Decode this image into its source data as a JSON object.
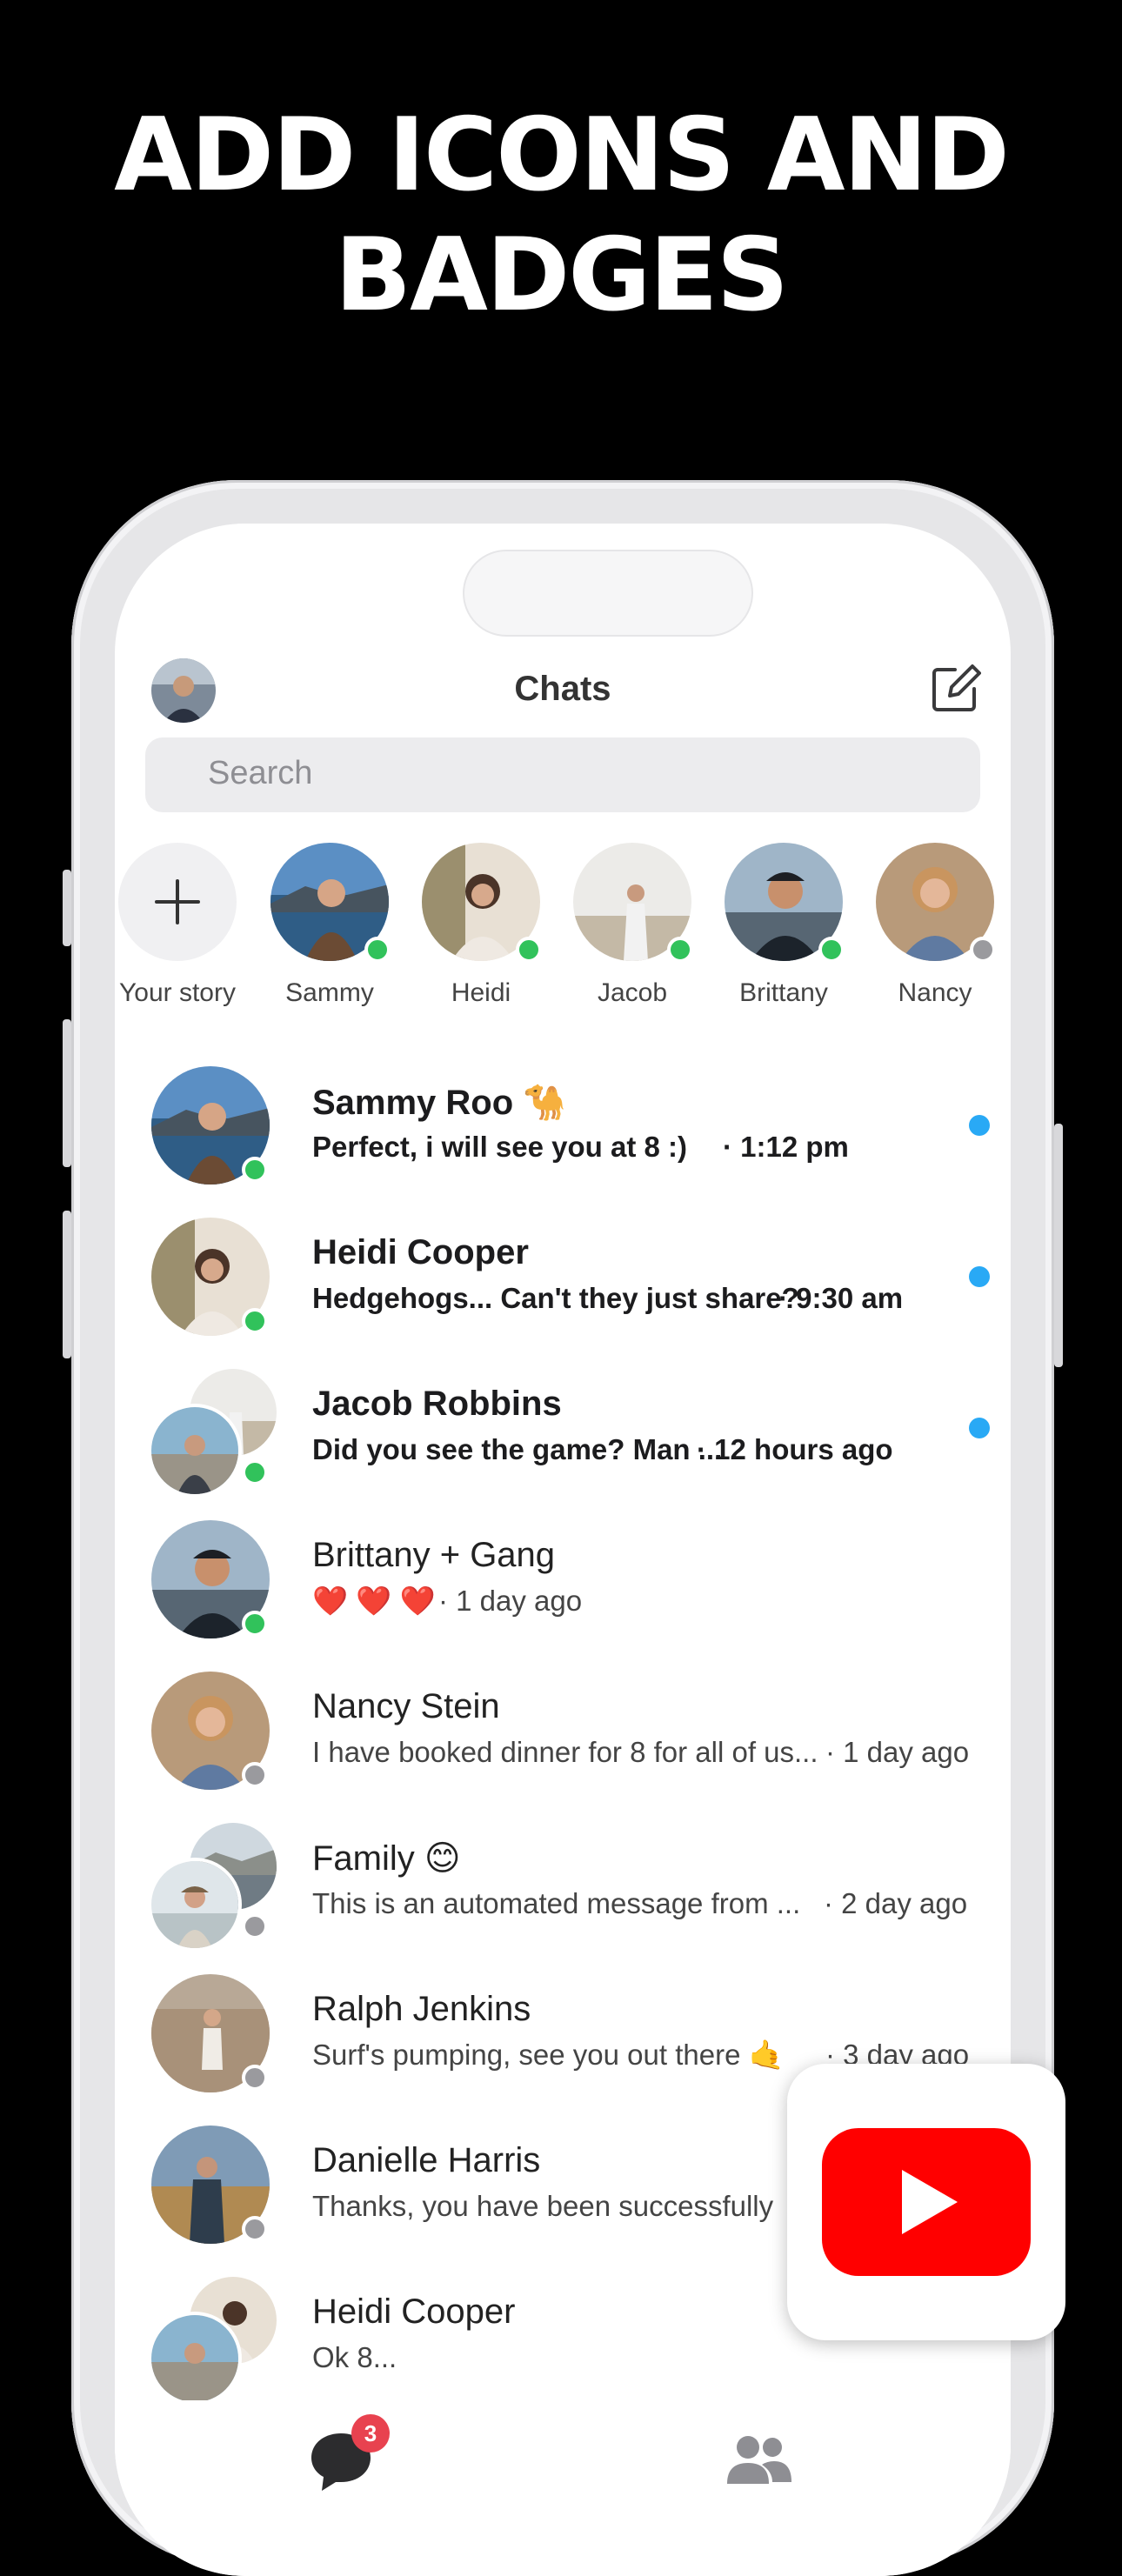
{
  "headline": {
    "line1": "ADD ICONS AND",
    "line2": "BADGES"
  },
  "header": {
    "title": "Chats",
    "avatar_icon": "profile-avatar",
    "compose_icon": "compose-icon"
  },
  "search": {
    "placeholder": "Search"
  },
  "stories": [
    {
      "label": "Your story",
      "type": "add"
    },
    {
      "label": "Sammy",
      "status": "online"
    },
    {
      "label": "Heidi",
      "status": "online"
    },
    {
      "label": "Jacob",
      "status": "online"
    },
    {
      "label": "Brittany",
      "status": "online"
    },
    {
      "label": "Nancy",
      "status": "offline"
    }
  ],
  "chats": [
    {
      "name": "Sammy Roo",
      "name_emoji": "🐪",
      "message": "Perfect, i will see you at 8 :)",
      "time": "· 1:12 pm",
      "unread": true,
      "status": "online"
    },
    {
      "name": "Heidi Cooper",
      "message": "Hedgehogs... Can't they just share?",
      "time": "· 9:30 am",
      "unread": true,
      "status": "online"
    },
    {
      "name": "Jacob Robbins",
      "message": "Did you see the game? Man ...",
      "time": "· 12 hours ago",
      "unread": true,
      "status": "online"
    },
    {
      "name": "Brittany + Gang",
      "message": "❤️ ❤️ ❤️",
      "time": "· 1 day ago",
      "unread": false,
      "status": "online"
    },
    {
      "name": "Nancy Stein",
      "message": "I have booked dinner for 8 for all of us...",
      "time": "· 1 day ago",
      "unread": false,
      "status": "offline"
    },
    {
      "name": "Family",
      "name_emoji": "😊",
      "message": "This is an automated message from ...",
      "time": "· 2 day ago",
      "unread": false,
      "status": "offline"
    },
    {
      "name": "Ralph Jenkins",
      "message": "Surf's pumping, see you out there 🤙",
      "time": "· 3 day ago",
      "unread": false,
      "status": "offline"
    },
    {
      "name": "Danielle Harris",
      "message": "Thanks, you have been successfully",
      "time": "",
      "unread": false,
      "status": "offline"
    },
    {
      "name": "Heidi Cooper",
      "message": "Ok 8...",
      "time": "",
      "unread": false,
      "status": "offline"
    }
  ],
  "tabbar": {
    "chats_badge": "3",
    "chats_icon": "chat-bubble-icon",
    "people_icon": "people-icon"
  },
  "overlay": {
    "icon": "youtube-logo"
  },
  "colors": {
    "online": "#31c25b",
    "offline": "#9a9a9e",
    "unread_dot": "#29a9f5",
    "badge": "#e8424f",
    "youtube_red": "#ff0000",
    "background": "#000000"
  }
}
